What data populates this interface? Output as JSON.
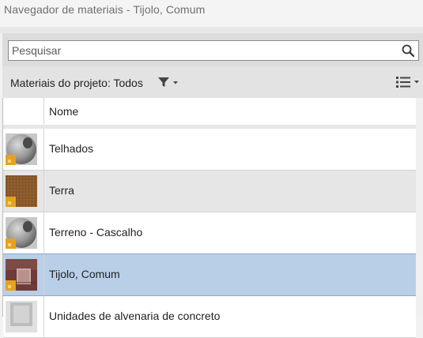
{
  "window": {
    "title": "Navegador de materiais - Tijolo, Comum"
  },
  "search": {
    "placeholder": "Pesquisar",
    "value": ""
  },
  "toolbar": {
    "filter_label": "Materiais do projeto: Todos"
  },
  "table": {
    "columns": [
      "",
      "Nome"
    ],
    "rows": [
      {
        "name": "Telhados",
        "thumbnail": "concrete-sphere",
        "state": "normal"
      },
      {
        "name": "Terra",
        "thumbnail": "earth-texture",
        "state": "alt"
      },
      {
        "name": "Terreno - Cascalho",
        "thumbnail": "concrete-sphere",
        "state": "normal"
      },
      {
        "name": "Tijolo, Comum",
        "thumbnail": "brick-texture",
        "state": "selected"
      },
      {
        "name": "Unidades de alvenaria de concreto",
        "thumbnail": "concrete-block",
        "state": "normal"
      }
    ]
  },
  "colors": {
    "selected_row": "#b9cfe8",
    "alt_row": "#e6e6e6",
    "badge": "#e6a21c"
  }
}
